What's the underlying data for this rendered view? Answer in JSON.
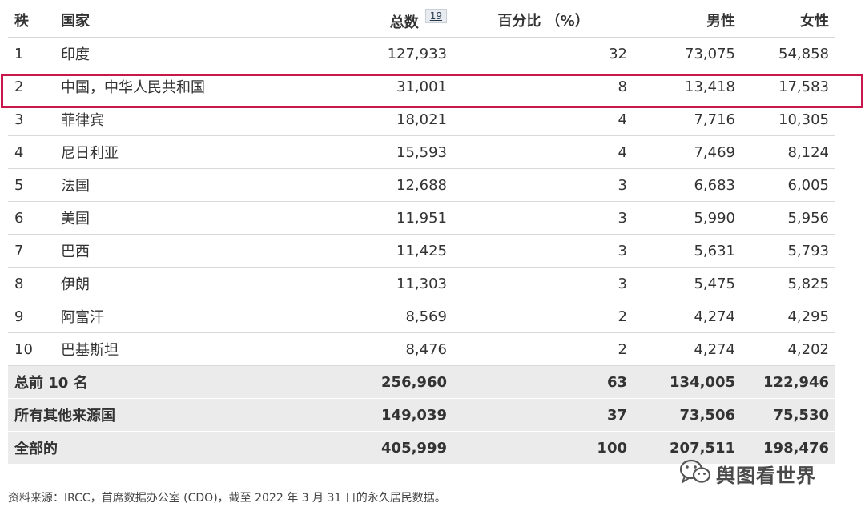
{
  "table": {
    "headers": {
      "rank": "秩",
      "country": "国家",
      "total": "总数",
      "total_footnote": "19",
      "percent": "百分比 （%）",
      "male": "男性",
      "female": "女性"
    },
    "rows": [
      {
        "rank": "1",
        "country": "印度",
        "total": "127,933",
        "percent": "32",
        "male": "73,075",
        "female": "54,858"
      },
      {
        "rank": "2",
        "country": "中国，中华人民共和国",
        "total": "31,001",
        "percent": "8",
        "male": "13,418",
        "female": "17,583"
      },
      {
        "rank": "3",
        "country": "菲律宾",
        "total": "18,021",
        "percent": "4",
        "male": "7,716",
        "female": "10,305"
      },
      {
        "rank": "4",
        "country": "尼日利亚",
        "total": "15,593",
        "percent": "4",
        "male": "7,469",
        "female": "8,124"
      },
      {
        "rank": "5",
        "country": "法国",
        "total": "12,688",
        "percent": "3",
        "male": "6,683",
        "female": "6,005"
      },
      {
        "rank": "6",
        "country": "美国",
        "total": "11,951",
        "percent": "3",
        "male": "5,990",
        "female": "5,956"
      },
      {
        "rank": "7",
        "country": "巴西",
        "total": "11,425",
        "percent": "3",
        "male": "5,631",
        "female": "5,793"
      },
      {
        "rank": "8",
        "country": "伊朗",
        "total": "11,303",
        "percent": "3",
        "male": "5,475",
        "female": "5,825"
      },
      {
        "rank": "9",
        "country": "阿富汗",
        "total": "8,569",
        "percent": "2",
        "male": "4,274",
        "female": "4,295"
      },
      {
        "rank": "10",
        "country": "巴基斯坦",
        "total": "8,476",
        "percent": "2",
        "male": "4,274",
        "female": "4,202"
      }
    ],
    "summary": [
      {
        "label": "总前 10 名",
        "total": "256,960",
        "percent": "63",
        "male": "134,005",
        "female": "122,946"
      },
      {
        "label": "所有其他来源国",
        "total": "149,039",
        "percent": "37",
        "male": "73,506",
        "female": "75,530"
      },
      {
        "label": "全部的",
        "total": "405,999",
        "percent": "100",
        "male": "207,511",
        "female": "198,476"
      }
    ]
  },
  "highlight_color": "#c8174b",
  "source_note": "资料来源：IRCC，首席数据办公室 (CDO)，截至 2022 年 3 月 31 日的永久居民数据。",
  "watermark": {
    "text": "舆图看世界",
    "icon": "wechat-icon"
  }
}
